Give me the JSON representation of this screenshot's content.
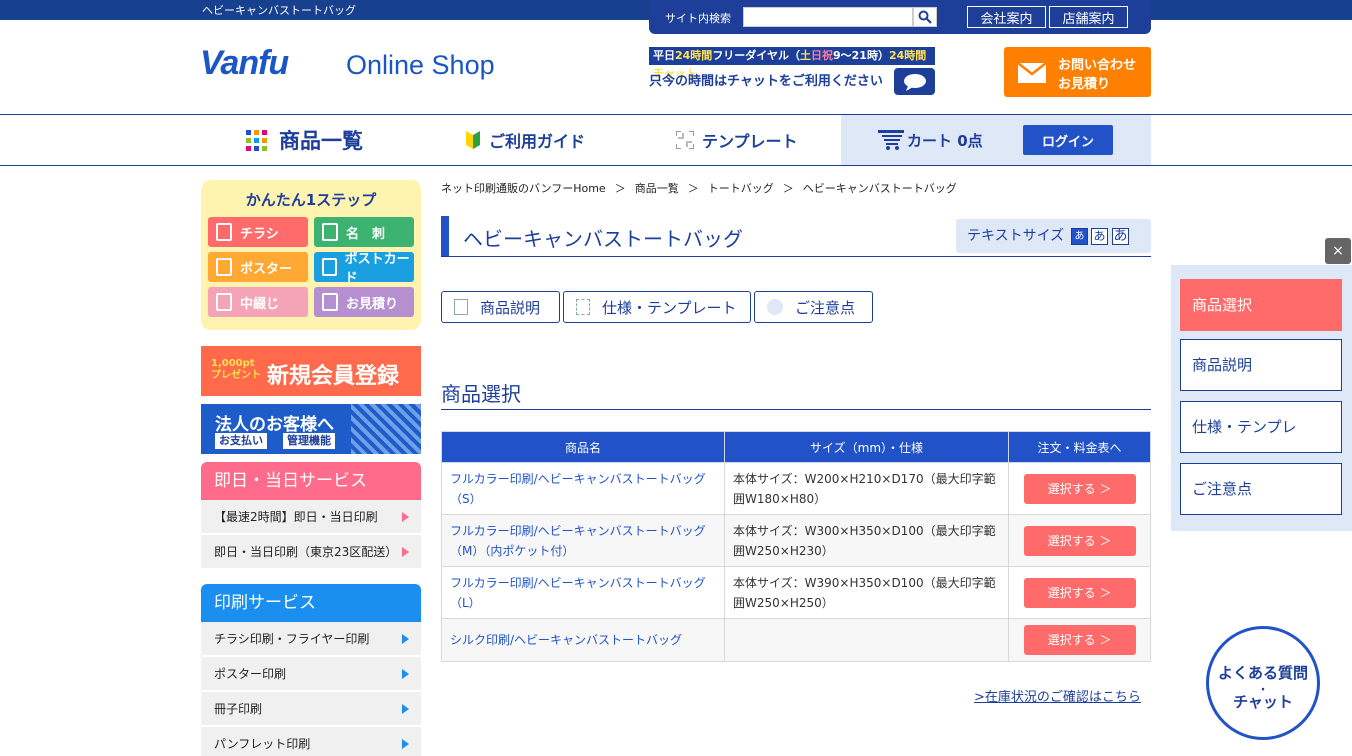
{
  "header": {
    "top_title": "ヘビーキャンバストートバッグ",
    "search_label": "サイト内検索",
    "search_placeholder": "",
    "links": [
      "会社案内",
      "店舗案内"
    ],
    "logo_brand": "Vanfu",
    "logo_text": "Online Shop",
    "phone_top_a": "平日",
    "phone_top_b": "24時間",
    "phone_top_c": "フリーダイヤル（",
    "phone_top_d": "土",
    "phone_top_e": "日祝",
    "phone_top_f": "9～21時）",
    "phone_top_g": "24時間チャット",
    "phone_bottom": "只今の時間はチャットをご利用ください",
    "contact_line1": "お問い合わせ",
    "contact_line2": "お見積り"
  },
  "nav": {
    "items": [
      "商品一覧",
      "ご利用ガイド",
      "テンプレート"
    ],
    "cart": "カート",
    "cart_count": "0点",
    "login": "ログイン"
  },
  "sidebar": {
    "step_title": "かんたん1ステップ",
    "step_buttons": [
      "チラシ",
      "名　刺",
      "ポスター",
      "ポストカード",
      "中綴じ",
      "お見積り"
    ],
    "banner_member_pt": "1,000pt",
    "banner_member_pt2": "プレゼント",
    "banner_member": "新規会員登録",
    "banner_corp": "法人のお客様へ",
    "banner_corp_tags": [
      "お支払い",
      "管理機能"
    ],
    "sections": [
      {
        "title": "即日・当日サービス",
        "items": [
          "【最速2時間】即日・当日印刷",
          "即日・当日印刷（東京23区配送）"
        ]
      },
      {
        "title": "印刷サービス",
        "items": [
          "チラシ印刷・フライヤー印刷",
          "ポスター印刷",
          "冊子印刷",
          "パンフレット印刷"
        ]
      }
    ]
  },
  "main": {
    "breadcrumb": [
      "ネット印刷通販のバンフーHome",
      "商品一覧",
      "トートバッグ",
      "ヘビーキャンバストートバッグ"
    ],
    "title": "ヘビーキャンバストートバッグ",
    "text_size_label": "テキストサイズ",
    "text_size_btns": [
      "あ",
      "あ",
      "あ"
    ],
    "tabs": [
      "商品説明",
      "仕様・テンプレート",
      "ご注意点"
    ],
    "section_title": "商品選択",
    "table_headers": [
      "商品名",
      "サイズ（mm）・仕様",
      "注文・料金表へ"
    ],
    "rows": [
      {
        "name": "フルカラー印刷/ヘビーキャンバストートバッグ（S）",
        "size": "本体サイズ：W200×H210×D170（最大印字範囲W180×H80）",
        "action": "選択する ＞"
      },
      {
        "name": "フルカラー印刷/ヘビーキャンバストートバッグ（M）（内ポケット付）",
        "size": "本体サイズ：W300×H350×D100（最大印字範囲W250×H230）",
        "action": "選択する ＞"
      },
      {
        "name": "フルカラー印刷/ヘビーキャンバストートバッグ（L）",
        "size": "本体サイズ：W390×H350×D100（最大印字範囲W250×H250）",
        "action": "選択する ＞"
      },
      {
        "name": "シルク印刷/ヘビーキャンバストートバッグ",
        "size": "",
        "action": "選択する ＞"
      }
    ],
    "stock_link": ">在庫状況のご確認はこちら"
  },
  "float_menu": {
    "close": "×",
    "items": [
      "商品選択",
      "商品説明",
      "仕様・テンプレ",
      "ご注意点"
    ]
  },
  "faq": {
    "line1": "よくある質問",
    "line2": "・",
    "line3": "チャット"
  },
  "colors": {
    "brand": "#1d3f9a",
    "accent": "#2152c8",
    "orange": "#ff8000",
    "coral": "#ff6b6b"
  }
}
